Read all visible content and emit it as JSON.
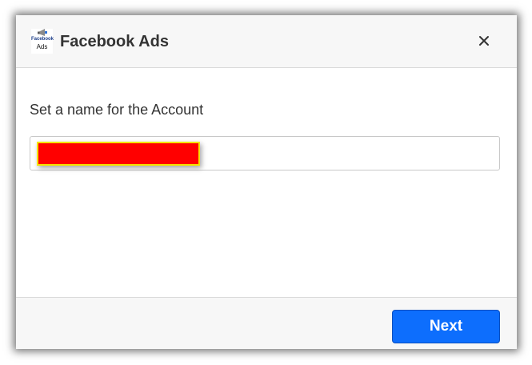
{
  "dialog": {
    "title": "Facebook Ads",
    "logo": {
      "line1": "Facebook",
      "line2": "Ads"
    },
    "close_icon": "close-icon"
  },
  "form": {
    "label": "Set a name for the Account",
    "name_value": "",
    "redacted": true,
    "redaction_color": "#ff0000",
    "redaction_border_color": "#f5e400"
  },
  "footer": {
    "next_label": "Next"
  },
  "colors": {
    "primary_button": "#0d6efd",
    "header_bg": "#f7f7f7"
  }
}
